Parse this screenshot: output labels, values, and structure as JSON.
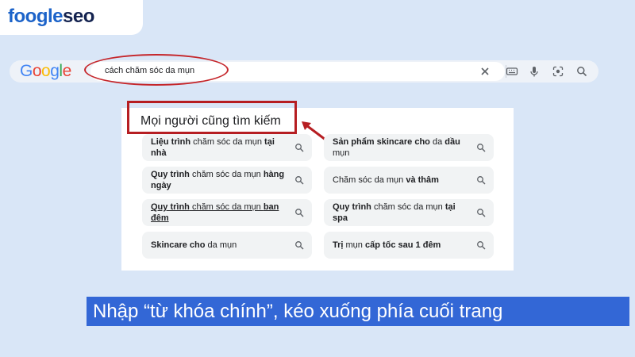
{
  "brand": {
    "logo_part1": "foogle",
    "logo_part2": "seo"
  },
  "google": {
    "logo_letters": [
      {
        "ch": "G",
        "color": "#4285f4"
      },
      {
        "ch": "o",
        "color": "#ea4335"
      },
      {
        "ch": "o",
        "color": "#fbbc05"
      },
      {
        "ch": "g",
        "color": "#4285f4"
      },
      {
        "ch": "l",
        "color": "#34a853"
      },
      {
        "ch": "e",
        "color": "#ea4335"
      }
    ],
    "query": "cách chăm sóc da mụn",
    "icons": [
      "close-icon",
      "keyboard-icon",
      "mic-icon",
      "lens-icon",
      "search-icon"
    ]
  },
  "people_also_search": {
    "heading": "Mọi người cũng tìm kiếm",
    "chips": [
      {
        "segments": [
          {
            "t": "Liệu trình",
            "b": true
          },
          {
            "t": " chăm sóc da mụn ",
            "b": false
          },
          {
            "t": "tại nhà",
            "b": true
          }
        ],
        "underline": false
      },
      {
        "segments": [
          {
            "t": "Sản phẩm skincare cho",
            "b": true
          },
          {
            "t": " da ",
            "b": false
          },
          {
            "t": "dầu",
            "b": true
          },
          {
            "t": " mụn",
            "b": false
          }
        ],
        "underline": false
      },
      {
        "segments": [
          {
            "t": "Quy trình",
            "b": true
          },
          {
            "t": " chăm sóc da mụn ",
            "b": false
          },
          {
            "t": "hàng ngày",
            "b": true
          }
        ],
        "underline": false
      },
      {
        "segments": [
          {
            "t": "Chăm sóc da mụn ",
            "b": false
          },
          {
            "t": "và thâm",
            "b": true
          }
        ],
        "underline": false
      },
      {
        "segments": [
          {
            "t": "Quy trình",
            "b": true
          },
          {
            "t": " chăm sóc da mụn ",
            "b": false
          },
          {
            "t": "ban đêm",
            "b": true
          }
        ],
        "underline": true
      },
      {
        "segments": [
          {
            "t": "Quy trình",
            "b": true
          },
          {
            "t": " chăm sóc da mụn ",
            "b": false
          },
          {
            "t": "tại spa",
            "b": true
          }
        ],
        "underline": false
      },
      {
        "segments": [
          {
            "t": "Skincare cho",
            "b": true
          },
          {
            "t": " da mụn",
            "b": false
          }
        ],
        "underline": false
      },
      {
        "segments": [
          {
            "t": "Trị",
            "b": true
          },
          {
            "t": " mụn ",
            "b": false
          },
          {
            "t": "cấp tốc sau 1 đêm",
            "b": true
          }
        ],
        "underline": false
      }
    ]
  },
  "banner": {
    "text": "Nhập “từ khóa chính”, kéo xuống phía cuối trang"
  },
  "colors": {
    "background": "#d9e6f7",
    "annotation_red": "#b61e22",
    "banner_blue": "#3367d6",
    "brand_blue": "#1c63c9",
    "brand_navy": "#13224f"
  }
}
